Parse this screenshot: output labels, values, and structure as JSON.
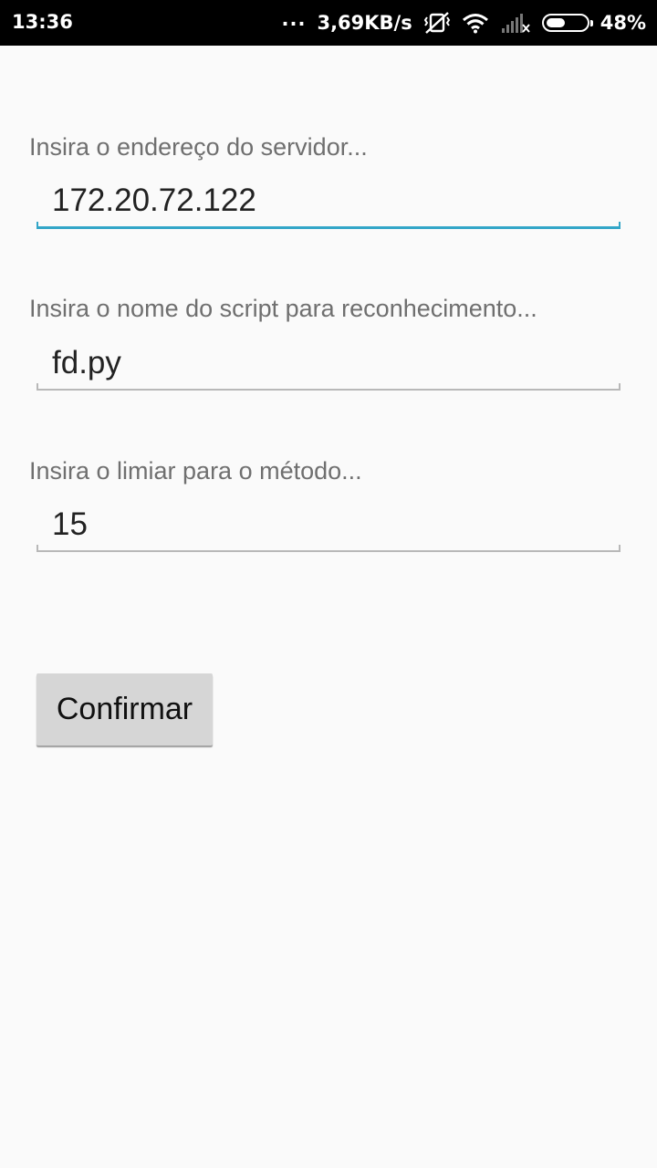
{
  "status_bar": {
    "time": "13:36",
    "dots": "...",
    "network_speed": "3,69KB/s",
    "battery_percent": "48%",
    "battery_level": 0.48,
    "icons": [
      "vibrate-off-icon",
      "wifi-icon",
      "signal-off-icon",
      "battery-icon"
    ]
  },
  "form": {
    "server": {
      "label": "Insira o endereço do servidor...",
      "value": "172.20.72.122",
      "focused": true
    },
    "script": {
      "label": "Insira o nome do script para reconhecimento...",
      "value": "fd.py"
    },
    "threshold": {
      "label": "Insira o limiar para o método...",
      "value": "15"
    },
    "confirm_label": "Confirmar"
  },
  "colors": {
    "accent": "#33a6c8",
    "background": "#fafafa",
    "button": "#d6d6d6"
  }
}
